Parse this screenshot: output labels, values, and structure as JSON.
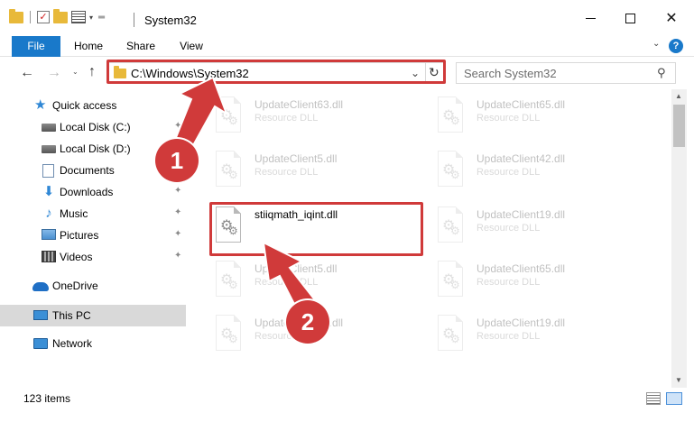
{
  "window": {
    "title": "System32",
    "controls": {
      "minimize": "minimize",
      "maximize": "maximize",
      "close": "✕"
    }
  },
  "quick_access_toolbar": {
    "check": "✓",
    "dropdown": "▾",
    "customize": "═"
  },
  "ribbon": {
    "tabs": [
      {
        "label": "File"
      },
      {
        "label": "Home"
      },
      {
        "label": "Share"
      },
      {
        "label": "View"
      }
    ],
    "collapse": "⌄",
    "help": "?"
  },
  "navigation": {
    "back": "←",
    "forward": "→",
    "recent": "⌄",
    "up": "↑",
    "address": "C:\\Windows\\System32",
    "address_dropdown": "⌄",
    "refresh": "↻",
    "search_placeholder": "Search System32",
    "search_icon": "⚲"
  },
  "sidebar": {
    "items": [
      {
        "label": "Quick access",
        "icon": "star-icon",
        "pinned": false
      },
      {
        "label": "Local Disk (C:)",
        "icon": "disk-icon",
        "pinned": true
      },
      {
        "label": "Local Disk (D:)",
        "icon": "disk-icon",
        "pinned": false
      },
      {
        "label": "Documents",
        "icon": "document-icon",
        "pinned": true
      },
      {
        "label": "Downloads",
        "icon": "download-icon",
        "pinned": true
      },
      {
        "label": "Music",
        "icon": "music-icon",
        "pinned": true
      },
      {
        "label": "Pictures",
        "icon": "pictures-icon",
        "pinned": true
      },
      {
        "label": "Videos",
        "icon": "videos-icon",
        "pinned": true
      },
      {
        "label": "OneDrive",
        "icon": "cloud-icon",
        "pinned": false
      },
      {
        "label": "This PC",
        "icon": "computer-icon",
        "pinned": false,
        "selected": true
      },
      {
        "label": "Network",
        "icon": "network-icon",
        "pinned": false
      }
    ],
    "pin_glyph": "📌"
  },
  "files": [
    {
      "name": "UpdateClient63.dll",
      "type": "Resource DLL",
      "faded": true
    },
    {
      "name": "UpdateClient65.dll",
      "type": "Resource DLL",
      "faded": true
    },
    {
      "name": "UpdateClient5.dll",
      "type": "Resource DLL",
      "faded": true
    },
    {
      "name": "UpdateClient42.dll",
      "type": "Resource DLL",
      "faded": true
    },
    {
      "name": "stiiqmath_iqint.dll",
      "type": "",
      "faded": false
    },
    {
      "name": "UpdateClient19.dll",
      "type": "Resource DLL",
      "faded": true
    },
    {
      "name": "UpdateClient5.dll",
      "type": "Resource DLL",
      "faded": true
    },
    {
      "name": "UpdateClient65.dll",
      "type": "Resource DLL",
      "faded": true
    },
    {
      "name": "UpdateClient65.dll",
      "type": "Resource DLL",
      "faded": true
    },
    {
      "name": "UpdateClient19.dll",
      "type": "Resource DLL",
      "faded": true
    }
  ],
  "status": {
    "count": "123 items"
  },
  "annotations": {
    "step1": "1",
    "step2": "2",
    "color": "#d03a3a"
  },
  "colors": {
    "accent": "#1979ca",
    "annotation": "#d03a3a",
    "selected_bg": "#d9d9d9"
  }
}
